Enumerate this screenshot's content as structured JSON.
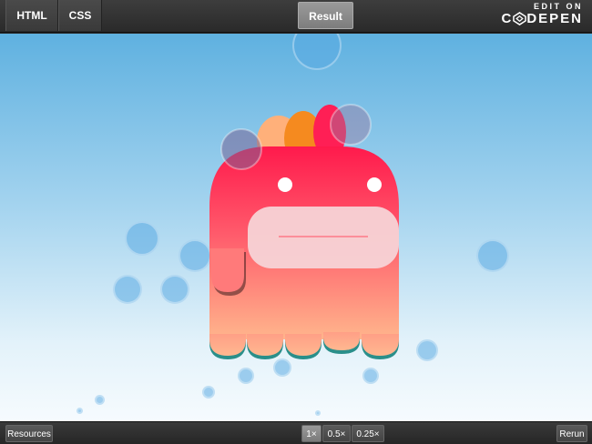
{
  "tabs": {
    "html": "HTML",
    "css": "CSS",
    "result": "Result"
  },
  "branding": {
    "edit_on": "EDIT ON",
    "codepen": "DEPEN",
    "codepen_prefix": "C"
  },
  "bottom": {
    "resources": "Resources",
    "zoom_1x": "1×",
    "zoom_05x": "0.5×",
    "zoom_025x": "0.25×",
    "rerun": "Rerun"
  },
  "colors": {
    "monster_top": "#ff1f4f",
    "monster_bottom": "#ffb08a",
    "mouth": "#f7d3d6",
    "sky_top": "#5fb1e0"
  }
}
